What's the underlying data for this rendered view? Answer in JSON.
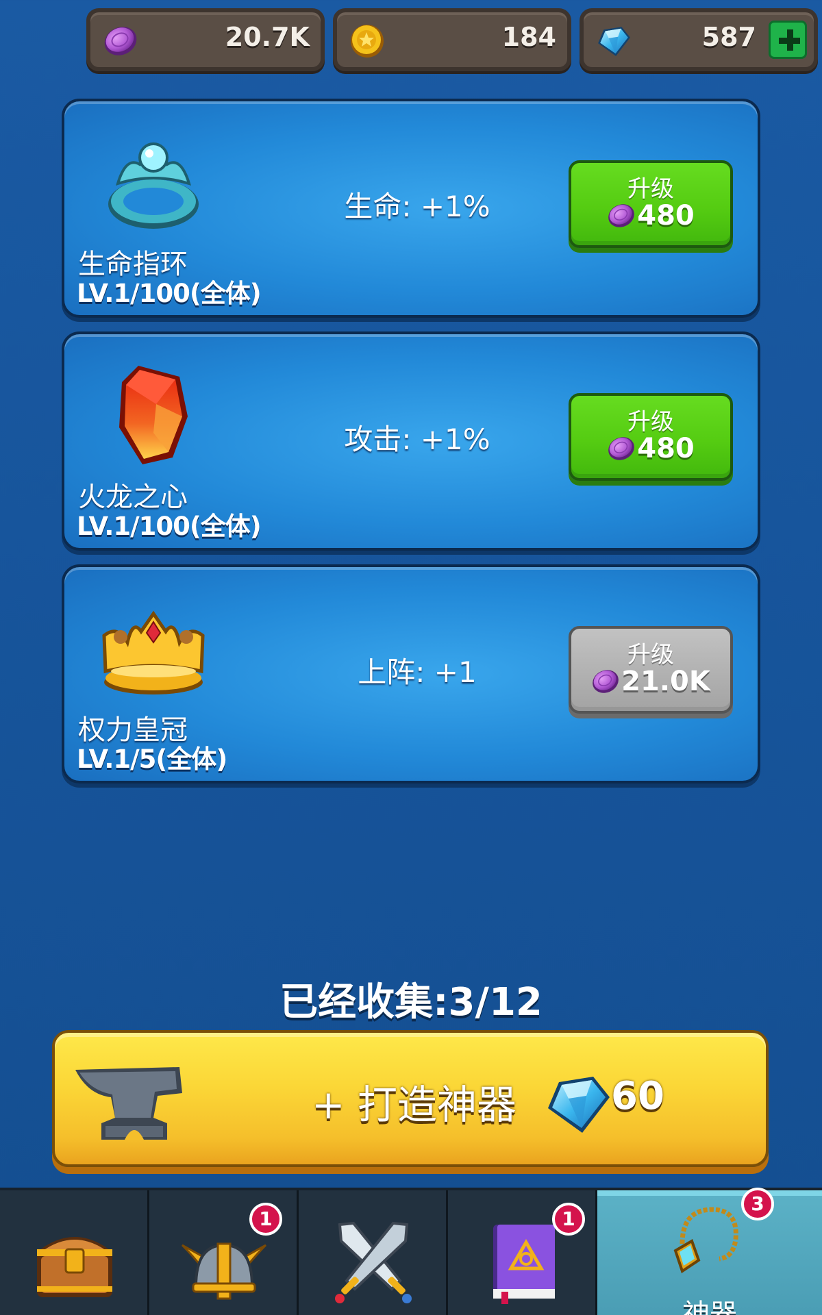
{
  "currencies": {
    "orbs": {
      "value": "20.7K",
      "icon": "purple-orb-icon",
      "color": "#b45cd6"
    },
    "coins": {
      "value": "184",
      "icon": "gold-coin-icon",
      "color": "#f5c21b"
    },
    "gems": {
      "value": "587",
      "icon": "blue-gem-icon",
      "color": "#3ab6ee",
      "add_icon": "plus-icon"
    }
  },
  "artifacts": [
    {
      "name": "生命指环",
      "level": "LV.1/100(全体)",
      "stat": "生命: +1%",
      "upgrade_label": "升级",
      "price": "480",
      "price_icon": "purple-orb-icon",
      "button_state": "enabled",
      "icon": "life-ring-icon"
    },
    {
      "name": "火龙之心",
      "level": "LV.1/100(全体)",
      "stat": "攻击: +1%",
      "upgrade_label": "升级",
      "price": "480",
      "price_icon": "purple-orb-icon",
      "button_state": "enabled",
      "icon": "dragon-heart-icon"
    },
    {
      "name": "权力皇冠",
      "level": "LV.1/5(全体)",
      "stat": "上阵: +1",
      "upgrade_label": "升级",
      "price": "21.0K",
      "price_icon": "purple-orb-icon",
      "button_state": "disabled",
      "icon": "crown-icon"
    }
  ],
  "collected": "已经收集:3/12",
  "forge": {
    "label": "+ 打造神器",
    "cost": "60",
    "cost_icon": "blue-gem-icon",
    "icon": "anvil-icon"
  },
  "nav": {
    "tabs": [
      {
        "icon": "treasure-chest-icon",
        "badge": null,
        "active": false
      },
      {
        "icon": "winged-helmet-icon",
        "badge": "1",
        "active": false
      },
      {
        "icon": "crossed-swords-icon",
        "badge": null,
        "active": false
      },
      {
        "icon": "spell-book-icon",
        "badge": "1",
        "active": false
      },
      {
        "icon": "amulet-icon",
        "badge": "3",
        "active": true,
        "label": "神器"
      }
    ]
  },
  "colors": {
    "upgrade_green": "#55cc12",
    "upgrade_disabled": "#b1b1b1",
    "forge_yellow": "#fbd737",
    "badge_red": "#d4134c",
    "active_tab": "#4a9db4"
  }
}
